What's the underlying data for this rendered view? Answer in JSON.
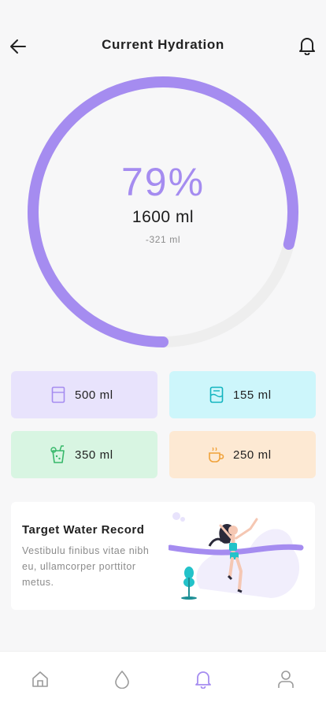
{
  "header": {
    "title": "Current Hydration",
    "back_icon": "arrow-left-icon",
    "notification_icon": "bell-icon"
  },
  "gauge": {
    "percent_text": "79%",
    "amount_text": "1600 ml",
    "difference_text": "-321 ml",
    "progress_fraction": 0.79,
    "accent_color": "#a58cf0",
    "track_color": "#eeeeee"
  },
  "drinks": [
    {
      "label": "500 ml",
      "icon": "glass-icon",
      "color": "#a58cf0",
      "background": "#e8e3fc"
    },
    {
      "label": "155 ml",
      "icon": "bottle-icon",
      "color": "#12b4bf",
      "background": "#cdf6fb"
    },
    {
      "label": "350 ml",
      "icon": "juice-icon",
      "color": "#37b86a",
      "background": "#d8f5e2"
    },
    {
      "label": "250 ml",
      "icon": "coffee-cup-icon",
      "color": "#f0a23a",
      "background": "#fde9d3"
    }
  ],
  "target_card": {
    "title": "Target Water Record",
    "body": "Vestibulu finibus vitae nibh eu, ullamcorper porttitor metus.",
    "illustration": "runner-finish-line-illustration"
  },
  "navbar": {
    "items": [
      {
        "icon": "home-icon",
        "active": false
      },
      {
        "icon": "water-drop-icon",
        "active": false
      },
      {
        "icon": "bell-icon",
        "active": true
      },
      {
        "icon": "user-icon",
        "active": false
      }
    ],
    "active_color": "#a58cf0",
    "inactive_color": "#9a9a9a"
  }
}
